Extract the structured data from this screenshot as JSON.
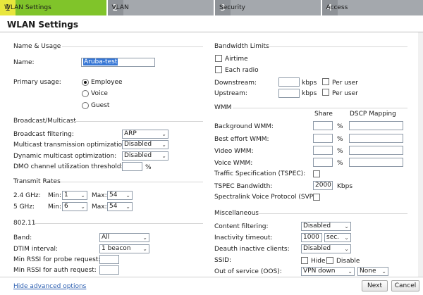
{
  "tabs": [
    {
      "num": "1",
      "label": "WLAN Settings"
    },
    {
      "num": "2",
      "label": "VLAN"
    },
    {
      "num": "3",
      "label": "Security"
    },
    {
      "num": "4",
      "label": "Access"
    }
  ],
  "title": "WLAN Settings",
  "name_usage": {
    "section": "Name & Usage",
    "name_label": "Name:",
    "name_value": "Aruba-test",
    "primary_usage_label": "Primary usage:",
    "options": [
      "Employee",
      "Voice",
      "Guest"
    ],
    "selected": "Employee"
  },
  "broadcast": {
    "section": "Broadcast/Multicast",
    "filtering_label": "Broadcast filtering:",
    "filtering_value": "ARP",
    "mto_label": "Multicast transmission optimization:",
    "mto_value": "Disabled",
    "dmo_label": "Dynamic multicast optimization:",
    "dmo_value": "Disabled",
    "dmo_thresh_label": "DMO channel utilization threshold:",
    "dmo_thresh_value": "",
    "pct": "%"
  },
  "rates": {
    "section": "Transmit Rates",
    "band24_label": "2.4 GHz:",
    "band5_label": "5 GHz:",
    "min_label": "Min:",
    "max_label": "Max:",
    "band24_min": "1",
    "band24_max": "54",
    "band5_min": "6",
    "band5_max": "54"
  },
  "dot11": {
    "section": "802.11",
    "band_label": "Band:",
    "band_value": "All",
    "dtim_label": "DTIM interval:",
    "dtim_value": "1 beacon",
    "rssi_probe_label": "Min RSSI for probe request:",
    "rssi_auth_label": "Min RSSI for auth request:",
    "rssi_probe_value": "",
    "rssi_auth_value": ""
  },
  "bandwidth": {
    "section": "Bandwidth Limits",
    "airtime": "Airtime",
    "each_radio": "Each radio",
    "downstream_label": "Downstream:",
    "upstream_label": "Upstream:",
    "kbps": "kbps",
    "per_user": "Per user"
  },
  "wmm": {
    "section": "WMM",
    "share_header": "Share",
    "dscp_header": "DSCP Mapping",
    "rows": [
      "Background WMM:",
      "Best effort WMM:",
      "Video WMM:",
      "Voice WMM:"
    ],
    "pct": "%",
    "tspec_label": "Traffic Specification (TSPEC):",
    "tspec_bw_label": "TSPEC Bandwidth:",
    "tspec_bw_value": "2000",
    "tspec_bw_unit": "Kbps",
    "svp_label": "Spectralink Voice Protocol (SVP):"
  },
  "misc": {
    "section": "Miscellaneous",
    "content_filtering_label": "Content filtering:",
    "content_filtering_value": "Disabled",
    "inactivity_label": "Inactivity timeout:",
    "inactivity_value": "1000",
    "inactivity_unit": "sec.",
    "deauth_label": "Deauth inactive clients:",
    "deauth_value": "Disabled",
    "ssid_label": "SSID:",
    "hide": "Hide",
    "disable": "Disable",
    "oos_label": "Out of service (OOS):",
    "oos_value": "VPN down",
    "oos_value2": "None"
  },
  "footer": {
    "advanced_link": "Hide advanced options",
    "next": "Next",
    "cancel": "Cancel"
  }
}
